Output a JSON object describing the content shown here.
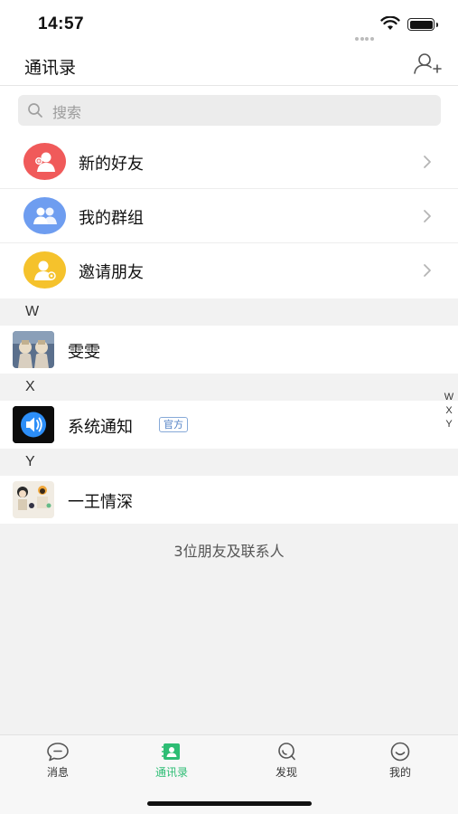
{
  "status_bar": {
    "time": "14:57"
  },
  "nav": {
    "title": "通讯录",
    "add_icon": "add-contact-icon"
  },
  "search": {
    "placeholder": "搜索",
    "icon": "search-icon"
  },
  "function_items": [
    {
      "label": "新的好友",
      "icon": "new-friend-icon",
      "color": "#f05a5a"
    },
    {
      "label": "我的群组",
      "icon": "group-icon",
      "color": "#6e9df0"
    },
    {
      "label": "邀请朋友",
      "icon": "invite-icon",
      "color": "#f5c22c"
    }
  ],
  "sections": [
    {
      "letter": "W",
      "contacts": [
        {
          "name": "雯雯",
          "badge": ""
        }
      ]
    },
    {
      "letter": "X",
      "contacts": [
        {
          "name": "系统通知",
          "badge": "官方"
        }
      ]
    },
    {
      "letter": "Y",
      "contacts": [
        {
          "name": "一王情深",
          "badge": ""
        }
      ]
    }
  ],
  "index_bar": [
    "W",
    "X",
    "Y"
  ],
  "contact_count": "3位朋友及联系人",
  "tabs": [
    {
      "label": "消息",
      "icon": "message-icon",
      "active": false
    },
    {
      "label": "通讯录",
      "icon": "contacts-icon",
      "active": true
    },
    {
      "label": "发现",
      "icon": "discover-icon",
      "active": false
    },
    {
      "label": "我的",
      "icon": "profile-icon",
      "active": false
    }
  ],
  "colors": {
    "accent": "#2dbd74",
    "background": "#f2f2f2"
  }
}
